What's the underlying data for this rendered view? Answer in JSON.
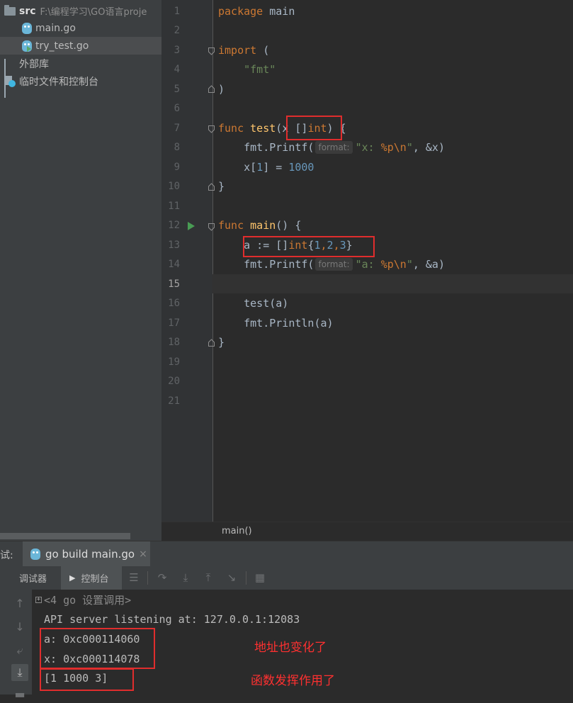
{
  "sidebar": {
    "root": {
      "name": "src",
      "path": "F:\\编程学习\\GO语言proje"
    },
    "files": [
      {
        "name": "main.go"
      },
      {
        "name": "try_test.go"
      }
    ],
    "external_libs": "外部库",
    "scratches": "临时文件和控制台"
  },
  "editor": {
    "line_numbers": [
      "1",
      "2",
      "3",
      "4",
      "5",
      "6",
      "7",
      "8",
      "9",
      "10",
      "11",
      "12",
      "13",
      "14",
      "15",
      "16",
      "17",
      "18",
      "19",
      "20",
      "21"
    ],
    "current_line": 15,
    "param_hint": "format:",
    "lines": {
      "l1_kw": "package",
      "l1_name": " main",
      "l3_kw": "import",
      "l3_rest": " (",
      "l4_str": "\"fmt\"",
      "l5": ")",
      "l7_kw": "func",
      "l7_fn": "test",
      "l7_open": "(",
      "l7_param": "x []",
      "l7_type": "int",
      "l7_rest": ") {",
      "l8_call": "fmt.Printf(",
      "l8_str_a": "\"x: ",
      "l8_esc_a": "%p",
      "l8_esc_b": "\\n",
      "l8_str_b": "\"",
      "l8_rest": ", &x)",
      "l9_a": "x[",
      "l9_n1": "1",
      "l9_b": "] = ",
      "l9_n2": "1000",
      "l10": "}",
      "l12_kw": "func",
      "l12_fn": "main",
      "l12_rest": "() {",
      "l13_a": "a := []",
      "l13_type": "int",
      "l13_b": "{",
      "l13_n1": "1",
      "l13_c1": ",",
      "l13_n2": "2",
      "l13_c2": ",",
      "l13_n3": "3",
      "l13_d": "}",
      "l14_call": "fmt.Printf(",
      "l14_str_a": "\"a: ",
      "l14_esc_a": "%p",
      "l14_esc_b": "\\n",
      "l14_str_b": "\"",
      "l14_rest": ", &a)",
      "l16": "test(a)",
      "l17": "fmt.Println(a)",
      "l18": "}"
    }
  },
  "breadcrumb": "main()",
  "tool_window": {
    "prefix": "试:",
    "run_tab": "go build main.go",
    "close": "×",
    "debugger_tab": "调试器",
    "console_tab": "控制台"
  },
  "console": {
    "lines": [
      "<4 go 设置调用>",
      "API server listening at: 127.0.0.1:12083",
      "a: 0xc000114060",
      "x: 0xc000114078",
      "[1 1000 3]"
    ],
    "notes": [
      "地址也变化了",
      "函数发挥作用了"
    ]
  },
  "colors": {
    "keyword": "#cc7832",
    "function": "#ffc66d",
    "string": "#6a8759",
    "number": "#6897bb",
    "annotation_red": "#e02d2d"
  }
}
